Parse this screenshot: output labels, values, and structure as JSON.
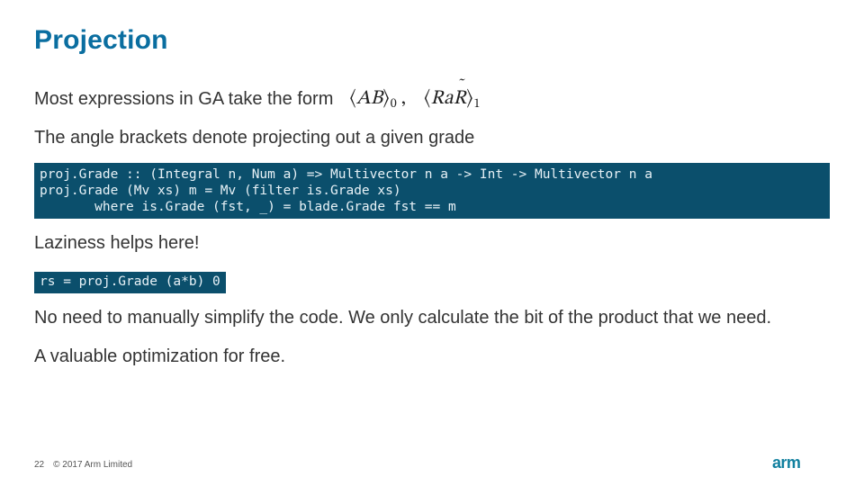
{
  "title": "Projection",
  "line1": "Most expressions in GA take the form",
  "math": {
    "ab": "AB",
    "rar": "RaR",
    "sub0": "0",
    "sub1": "1",
    "comma": ","
  },
  "line2": "The angle brackets denote projecting out a given grade",
  "code1": "proj.Grade :: (Integral n, Num a) => Multivector n a -> Int -> Multivector n a\nproj.Grade (Mv xs) m = Mv (filter is.Grade xs)\n       where is.Grade (fst, _) = blade.Grade fst == m",
  "line3": "Laziness helps here!",
  "code2": "rs = proj.Grade (a*b) 0",
  "line4": "No need to manually simplify the code. We only calculate the bit of the product that we need.",
  "line5": "A valuable optimization for free.",
  "footer": {
    "page": "22",
    "copyright": "© 2017 Arm Limited"
  },
  "logo_text": "arm",
  "colors": {
    "title": "#0a6ea0",
    "code_bg": "#0b4f6c",
    "logo": "#11809f"
  }
}
